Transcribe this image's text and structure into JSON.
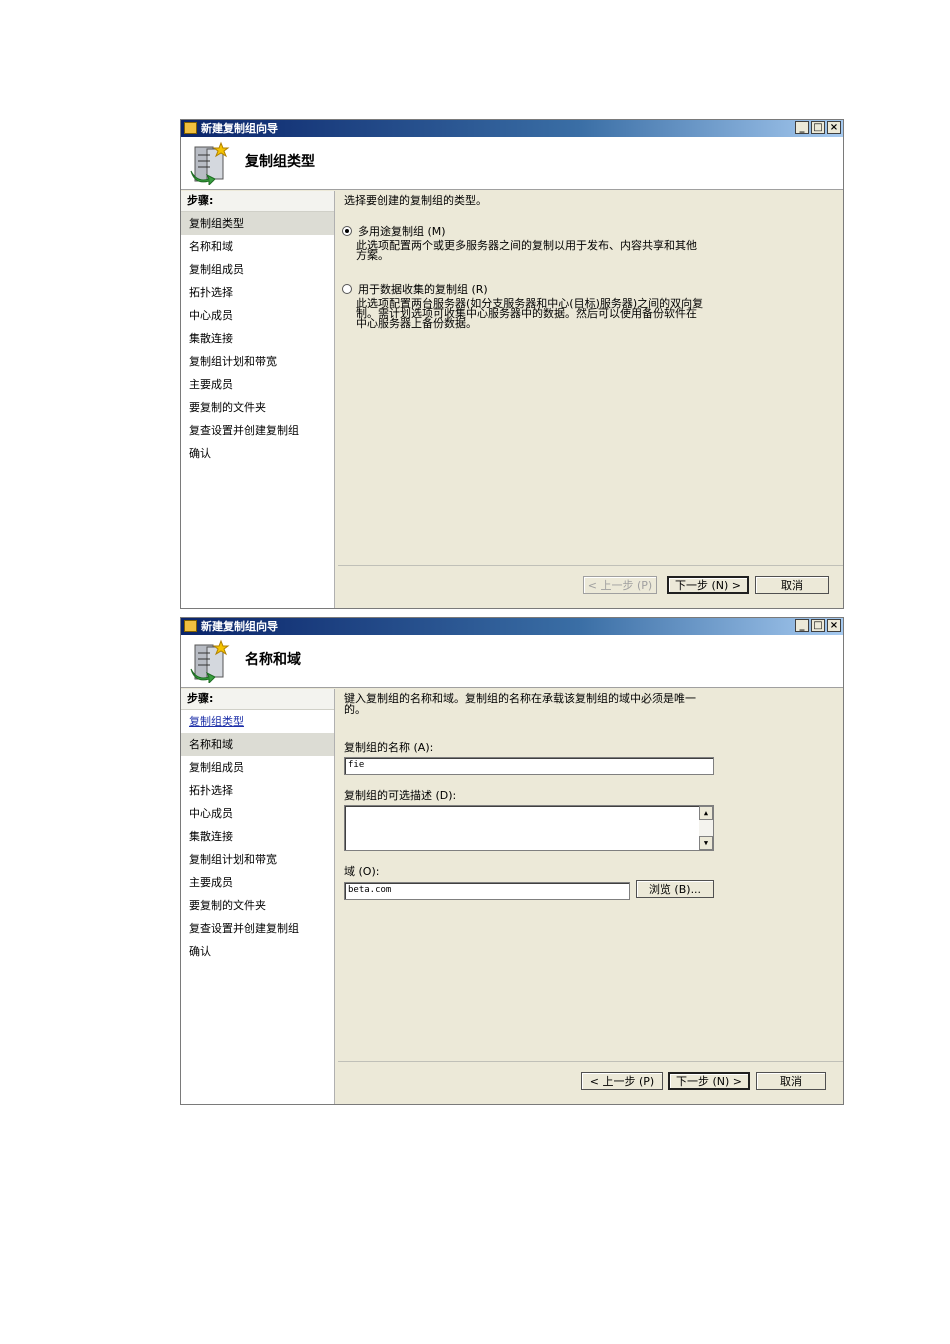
{
  "window1": {
    "title": "新建复制组向导",
    "header": "复制组类型",
    "steps_heading": "步骤:",
    "steps": [
      "复制组类型",
      "名称和域",
      "复制组成员",
      "拓扑选择",
      "中心成员",
      "集散连接",
      "复制组计划和带宽",
      "主要成员",
      "要复制的文件夹",
      "复查设置并创建复制组",
      "确认"
    ],
    "instruction": "选择要创建的复制组的类型。",
    "option1_label": "多用途复制组 (M)",
    "option1_desc": "此选项配置两个或更多服务器之间的复制以用于发布、内容共享和其他方案。",
    "option2_label": "用于数据收集的复制组 (R)",
    "option2_desc": "此选项配置两台服务器(如分支服务器和中心(目标)服务器)之间的双向复制。需计划选项可收集中心服务器中的数据。然后可以使用备份软件在中心服务器上备份数据。",
    "back": "< 上一步 (P)",
    "next": "下一步 (N) >",
    "cancel": "取消"
  },
  "window2": {
    "title": "新建复制组向导",
    "header": "名称和域",
    "steps_heading": "步骤:",
    "steps": [
      "复制组类型",
      "名称和域",
      "复制组成员",
      "拓扑选择",
      "中心成员",
      "集散连接",
      "复制组计划和带宽",
      "主要成员",
      "要复制的文件夹",
      "复查设置并创建复制组",
      "确认"
    ],
    "instruction": "键入复制组的名称和域。复制组的名称在承载该复制组的域中必须是唯一的。",
    "name_label": "复制组的名称 (A):",
    "name_value": "fie",
    "desc_label": "复制组的可选描述 (D):",
    "desc_value": "",
    "domain_label": "域 (O):",
    "domain_value": "beta.com",
    "browse": "浏览 (B)...",
    "back": "< 上一步 (P)",
    "next": "下一步 (N) >",
    "cancel": "取消"
  },
  "window_controls": {
    "minimize": "_",
    "maximize": "□",
    "close": "×"
  }
}
